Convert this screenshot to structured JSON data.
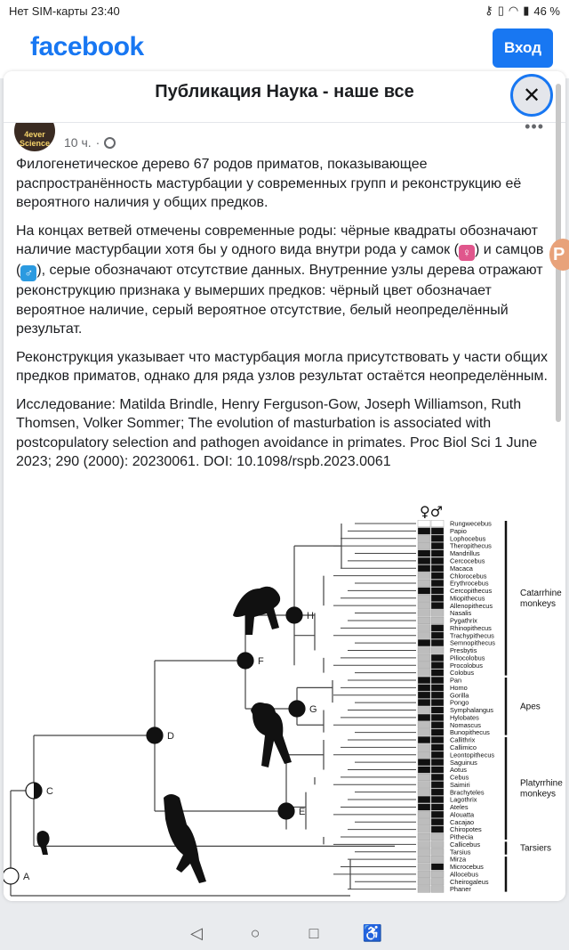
{
  "status_bar": {
    "left": "Нет SIM-карты 23:40",
    "battery": "46 %"
  },
  "header": {
    "logo": "facebook",
    "login": "Вход"
  },
  "dialog": {
    "title": "Публикация Наука - наше все",
    "close": "✕"
  },
  "post": {
    "avatar_text": "4ever Science",
    "time": "10 ч.",
    "paragraphs": [
      "Филогенетическое дерево 67 родов приматов, показывающее распространённость мастурбации у современных групп и реконструкцию её вероятного наличия у общих предков.",
      "Внутренние узлы дерева отражают реконструкцию признака у вымерших предков: чёрный цвет обозначает вероятное наличие, серый вероятное отсутствие, белый неопределённый результат.",
      "Реконструкция указывает что мастурбация могла присутствовать у части общих предков приматов, однако для ряда узлов результат остаётся неопределённым.",
      "Исследование: Matilda Brindle, Henry Ferguson-Gow, Joseph Williamson, Ruth Thomsen, Volker Sommer; The evolution of masturbation is associated with postcopulatory selection and pathogen avoidance in primates. Proc Biol Sci 1 June 2023; 290 (2000): 20230061. DOI: 10.1098/rspb.2023.0061"
    ],
    "para2_a": "На концах ветвей отмечены современные роды: чёрные квадраты обозначают наличие мастурбации хотя бы у одного вида внутри рода у самок (",
    "para2_b": ") и самцов (",
    "para2_c": "), серые обозначают отсутствие данных.",
    "female_symbol": "♀",
    "male_symbol": "♂"
  },
  "figure": {
    "header_symbols": "♀♂",
    "genera": [
      "Rungwecebus",
      "Papio",
      "Lophocebus",
      "Theropithecus",
      "Mandrillus",
      "Cercocebus",
      "Macaca",
      "Chlorocebus",
      "Erythrocebus",
      "Cercopithecus",
      "Miopithecus",
      "Allenopithecus",
      "Nasalis",
      "Pygathrix",
      "Rhinopithecus",
      "Trachypithecus",
      "Semnopithecus",
      "Presbytis",
      "Piliocolobus",
      "Procolobus",
      "Colobus",
      "Pan",
      "Homo",
      "Gorilla",
      "Pongo",
      "Symphalangus",
      "Hylobates",
      "Nomascus",
      "Bunopithecus",
      "Callithrix",
      "Callimico",
      "Leontopithecus",
      "Saguinus",
      "Aotus",
      "Cebus",
      "Saimiri",
      "Brachyteles",
      "Lagothrix",
      "Ateles",
      "Alouatta",
      "Cacajao",
      "Chiropotes",
      "Pithecia",
      "Callicebus",
      "Tarsius",
      "Mirza",
      "Microcebus",
      "Allocebus",
      "Cheirogaleus",
      "Phaner"
    ],
    "female_states": [
      "w",
      "k",
      "g",
      "g",
      "k",
      "k",
      "k",
      "g",
      "g",
      "k",
      "g",
      "g",
      "g",
      "g",
      "g",
      "g",
      "k",
      "g",
      "g",
      "g",
      "g",
      "k",
      "k",
      "k",
      "k",
      "g",
      "k",
      "g",
      "g",
      "k",
      "g",
      "g",
      "k",
      "k",
      "g",
      "g",
      "g",
      "k",
      "k",
      "g",
      "g",
      "g",
      "g",
      "g",
      "g",
      "g",
      "g",
      "g",
      "g",
      "g"
    ],
    "male_states": [
      "w",
      "k",
      "k",
      "k",
      "k",
      "k",
      "k",
      "k",
      "k",
      "k",
      "k",
      "k",
      "g",
      "g",
      "k",
      "k",
      "k",
      "g",
      "k",
      "k",
      "k",
      "k",
      "k",
      "k",
      "k",
      "k",
      "k",
      "k",
      "k",
      "k",
      "k",
      "k",
      "k",
      "k",
      "k",
      "k",
      "k",
      "k",
      "k",
      "k",
      "k",
      "k",
      "g",
      "g",
      "g",
      "g",
      "k",
      "g",
      "g",
      "g"
    ],
    "groups": [
      {
        "label": "Catarrhine monkeys",
        "from": 0,
        "to": 20
      },
      {
        "label": "Apes",
        "from": 21,
        "to": 28
      },
      {
        "label": "Platyrrhine monkeys",
        "from": 29,
        "to": 42
      },
      {
        "label": "Tarsiers",
        "from": 43,
        "to": 44
      },
      {
        "label": "",
        "from": 45,
        "to": 49
      }
    ],
    "nodes": [
      {
        "label": "H",
        "state": "black"
      },
      {
        "label": "F",
        "state": "black"
      },
      {
        "label": "G",
        "state": "black"
      },
      {
        "label": "D",
        "state": "black"
      },
      {
        "label": "E",
        "state": "black"
      },
      {
        "label": "C",
        "state": "half"
      },
      {
        "label": "A",
        "state": "white"
      }
    ]
  }
}
